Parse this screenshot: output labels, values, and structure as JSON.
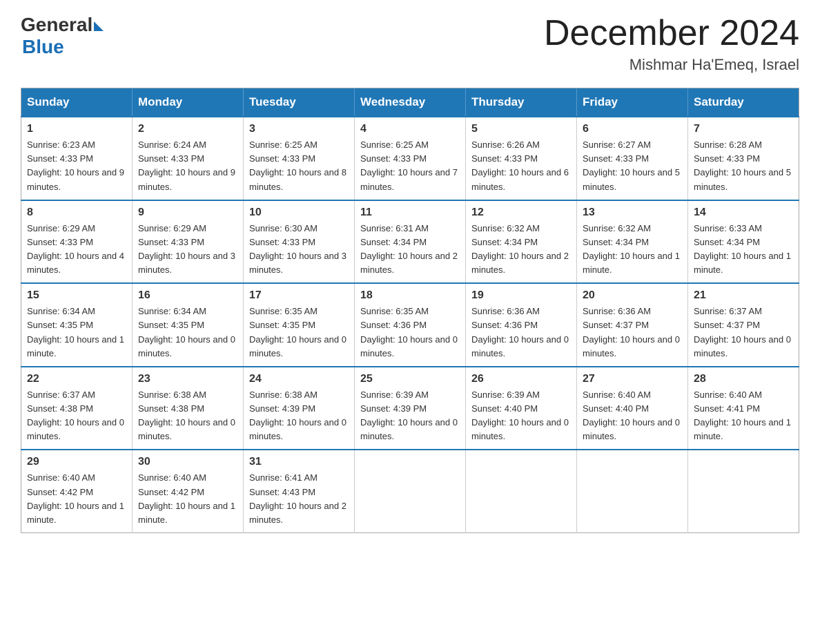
{
  "logo": {
    "general": "General",
    "blue": "Blue"
  },
  "title": "December 2024",
  "subtitle": "Mishmar Ha'Emeq, Israel",
  "header_days": [
    "Sunday",
    "Monday",
    "Tuesday",
    "Wednesday",
    "Thursday",
    "Friday",
    "Saturday"
  ],
  "weeks": [
    [
      {
        "day": "1",
        "sunrise": "6:23 AM",
        "sunset": "4:33 PM",
        "daylight": "10 hours and 9 minutes."
      },
      {
        "day": "2",
        "sunrise": "6:24 AM",
        "sunset": "4:33 PM",
        "daylight": "10 hours and 9 minutes."
      },
      {
        "day": "3",
        "sunrise": "6:25 AM",
        "sunset": "4:33 PM",
        "daylight": "10 hours and 8 minutes."
      },
      {
        "day": "4",
        "sunrise": "6:25 AM",
        "sunset": "4:33 PM",
        "daylight": "10 hours and 7 minutes."
      },
      {
        "day": "5",
        "sunrise": "6:26 AM",
        "sunset": "4:33 PM",
        "daylight": "10 hours and 6 minutes."
      },
      {
        "day": "6",
        "sunrise": "6:27 AM",
        "sunset": "4:33 PM",
        "daylight": "10 hours and 5 minutes."
      },
      {
        "day": "7",
        "sunrise": "6:28 AM",
        "sunset": "4:33 PM",
        "daylight": "10 hours and 5 minutes."
      }
    ],
    [
      {
        "day": "8",
        "sunrise": "6:29 AM",
        "sunset": "4:33 PM",
        "daylight": "10 hours and 4 minutes."
      },
      {
        "day": "9",
        "sunrise": "6:29 AM",
        "sunset": "4:33 PM",
        "daylight": "10 hours and 3 minutes."
      },
      {
        "day": "10",
        "sunrise": "6:30 AM",
        "sunset": "4:33 PM",
        "daylight": "10 hours and 3 minutes."
      },
      {
        "day": "11",
        "sunrise": "6:31 AM",
        "sunset": "4:34 PM",
        "daylight": "10 hours and 2 minutes."
      },
      {
        "day": "12",
        "sunrise": "6:32 AM",
        "sunset": "4:34 PM",
        "daylight": "10 hours and 2 minutes."
      },
      {
        "day": "13",
        "sunrise": "6:32 AM",
        "sunset": "4:34 PM",
        "daylight": "10 hours and 1 minute."
      },
      {
        "day": "14",
        "sunrise": "6:33 AM",
        "sunset": "4:34 PM",
        "daylight": "10 hours and 1 minute."
      }
    ],
    [
      {
        "day": "15",
        "sunrise": "6:34 AM",
        "sunset": "4:35 PM",
        "daylight": "10 hours and 1 minute."
      },
      {
        "day": "16",
        "sunrise": "6:34 AM",
        "sunset": "4:35 PM",
        "daylight": "10 hours and 0 minutes."
      },
      {
        "day": "17",
        "sunrise": "6:35 AM",
        "sunset": "4:35 PM",
        "daylight": "10 hours and 0 minutes."
      },
      {
        "day": "18",
        "sunrise": "6:35 AM",
        "sunset": "4:36 PM",
        "daylight": "10 hours and 0 minutes."
      },
      {
        "day": "19",
        "sunrise": "6:36 AM",
        "sunset": "4:36 PM",
        "daylight": "10 hours and 0 minutes."
      },
      {
        "day": "20",
        "sunrise": "6:36 AM",
        "sunset": "4:37 PM",
        "daylight": "10 hours and 0 minutes."
      },
      {
        "day": "21",
        "sunrise": "6:37 AM",
        "sunset": "4:37 PM",
        "daylight": "10 hours and 0 minutes."
      }
    ],
    [
      {
        "day": "22",
        "sunrise": "6:37 AM",
        "sunset": "4:38 PM",
        "daylight": "10 hours and 0 minutes."
      },
      {
        "day": "23",
        "sunrise": "6:38 AM",
        "sunset": "4:38 PM",
        "daylight": "10 hours and 0 minutes."
      },
      {
        "day": "24",
        "sunrise": "6:38 AM",
        "sunset": "4:39 PM",
        "daylight": "10 hours and 0 minutes."
      },
      {
        "day": "25",
        "sunrise": "6:39 AM",
        "sunset": "4:39 PM",
        "daylight": "10 hours and 0 minutes."
      },
      {
        "day": "26",
        "sunrise": "6:39 AM",
        "sunset": "4:40 PM",
        "daylight": "10 hours and 0 minutes."
      },
      {
        "day": "27",
        "sunrise": "6:40 AM",
        "sunset": "4:40 PM",
        "daylight": "10 hours and 0 minutes."
      },
      {
        "day": "28",
        "sunrise": "6:40 AM",
        "sunset": "4:41 PM",
        "daylight": "10 hours and 1 minute."
      }
    ],
    [
      {
        "day": "29",
        "sunrise": "6:40 AM",
        "sunset": "4:42 PM",
        "daylight": "10 hours and 1 minute."
      },
      {
        "day": "30",
        "sunrise": "6:40 AM",
        "sunset": "4:42 PM",
        "daylight": "10 hours and 1 minute."
      },
      {
        "day": "31",
        "sunrise": "6:41 AM",
        "sunset": "4:43 PM",
        "daylight": "10 hours and 2 minutes."
      },
      null,
      null,
      null,
      null
    ]
  ]
}
